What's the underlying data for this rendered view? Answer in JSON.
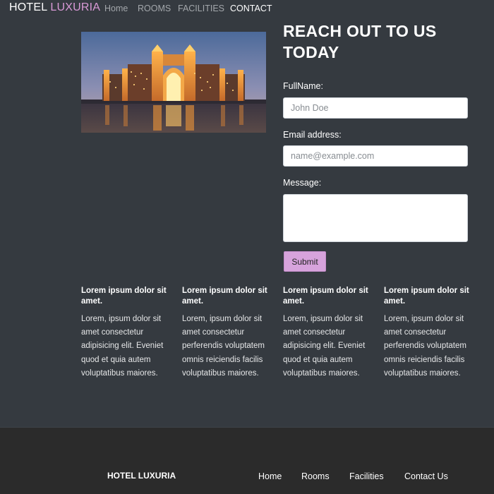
{
  "navbar": {
    "brand_primary": "HOTEL ",
    "brand_accent": "LUXURIA",
    "links": [
      {
        "label": "Home",
        "active": false
      },
      {
        "label": "ROOMS",
        "active": false
      },
      {
        "label": "FACILITIES",
        "active": false
      },
      {
        "label": "CONTACT",
        "active": true
      }
    ]
  },
  "contact": {
    "title": "REACH OUT TO US TODAY",
    "fullname_label": "FullName:",
    "fullname_placeholder": "John Doe",
    "email_label": "Email address:",
    "email_placeholder": "name@example.com",
    "message_label": "Message:",
    "submit_label": "Submit"
  },
  "features": [
    {
      "title": "Lorem ipsum dolor sit amet.",
      "text": "Lorem, ipsum dolor sit amet consectetur adipisicing elit. Eveniet quod et quia autem voluptatibus maiores."
    },
    {
      "title": "Lorem ipsum dolor sit amet.",
      "text": "Lorem, ipsum dolor sit amet consectetur perferendis voluptatem omnis reiciendis facilis voluptatibus maiores."
    },
    {
      "title": "Lorem ipsum dolor sit amet.",
      "text": "Lorem, ipsum dolor sit amet consectetur adipisicing elit. Eveniet quod et quia autem voluptatibus maiores."
    },
    {
      "title": "Lorem ipsum dolor sit amet.",
      "text": "Lorem, ipsum dolor sit amet consectetur perferendis voluptatem omnis reiciendis facilis voluptatibus maiores."
    }
  ],
  "footer": {
    "brand": "HOTEL LUXURIA",
    "links": [
      "Home",
      "Rooms",
      "Facilities",
      "Contact Us"
    ]
  },
  "colors": {
    "background": "#353a40",
    "accent": "#d99ad6",
    "button": "#d7a3dc",
    "footer": "#2b2b2b"
  }
}
